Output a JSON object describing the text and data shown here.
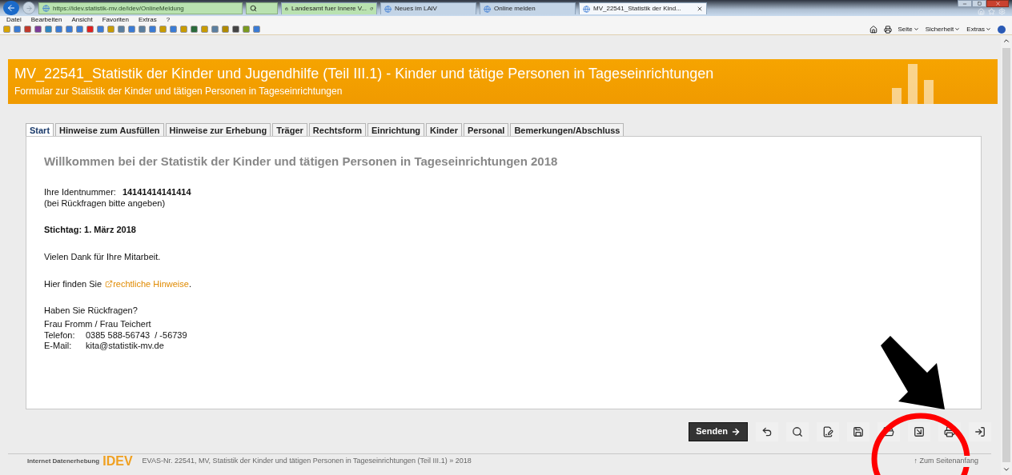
{
  "browser": {
    "address": "https://idev.statistik-mv.de/idev/OnlineMeldung",
    "tabs": [
      {
        "label": "Landesamt fuer Innere V...",
        "selected": false
      },
      {
        "label": "Neues im LAiV",
        "selected": false
      },
      {
        "label": "Online melden",
        "selected": false
      },
      {
        "label": "MV_22541_Statistik der Kind...",
        "selected": true
      }
    ],
    "menu": [
      "Datei",
      "Bearbeiten",
      "Ansicht",
      "Favoriten",
      "Extras",
      "?"
    ],
    "command_bar": [
      "Seite",
      "Sicherheit",
      "Extras"
    ]
  },
  "header": {
    "title": "MV_22541_Statistik der Kinder und Jugendhilfe (Teil III.1) - Kinder und tätige Personen in Tageseinrichtungen",
    "subtitle": "Formular zur Statistik der Kinder und tätigen Personen in Tageseinrichtungen"
  },
  "form_tabs": [
    {
      "label": "Start",
      "selected": true
    },
    {
      "label": "Hinweise zum Ausfüllen",
      "selected": false
    },
    {
      "label": "Hinweise zur Erhebung",
      "selected": false
    },
    {
      "label": "Träger",
      "selected": false
    },
    {
      "label": "Rechtsform",
      "selected": false
    },
    {
      "label": "Einrichtung",
      "selected": false
    },
    {
      "label": "Kinder",
      "selected": false
    },
    {
      "label": "Personal",
      "selected": false
    },
    {
      "label": "Bemerkungen/Abschluss",
      "selected": false
    }
  ],
  "content": {
    "heading": "Willkommen bei der Statistik der Kinder und tätigen Personen in Tageseinrichtungen 2018",
    "id_label": "Ihre Identnummer:",
    "id_value": "14141414141414",
    "id_note": "(bei Rückfragen bitte angeben)",
    "deadline": "Stichtag: 1. März 2018",
    "thanks": "Vielen Dank für Ihre Mitarbeit.",
    "legal_prefix": "Hier finden Sie",
    "legal_link": "rechtliche Hinweise",
    "legal_suffix": ".",
    "contact_heading": "Haben Sie Rückfragen?",
    "contact_names": "Frau Fromm / Frau Teichert",
    "phone_label": "Telefon:",
    "phone_value": "0385 588-56743  / -56739",
    "email_label": "E-Mail:",
    "email_value": "kita@statistik-mv.de"
  },
  "toolbar": {
    "send_button": "Senden"
  },
  "footer": {
    "brand_text": "Internet Datenerhebung",
    "logo": "IDEV",
    "evas": "EVAS-Nr. 22541, MV, Statistik der Kinder und tätigen Personen in Tageseinrichtungen (Teil III.1) » 2018",
    "top_link": "↑ Zum Seitenanfang"
  }
}
